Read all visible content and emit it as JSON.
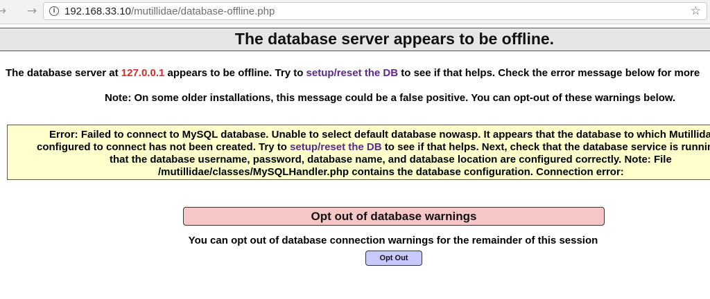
{
  "browser": {
    "back_glyph": "→",
    "forward_glyph": "→",
    "info_glyph": "i",
    "url_host": "192.168.33.10",
    "url_path": "/mutillidae/database-offline.php",
    "star_glyph": "☆"
  },
  "page": {
    "title": "The database server appears to be offline.",
    "line1_prefix": "The database server at ",
    "ip": "127.0.0.1",
    "line1_mid": " appears to be offline. Try to ",
    "setup_link": "setup/reset the DB",
    "line1_suffix": " to see if that helps. Check the error message below for more",
    "note": "Note: On some older installations, this message could be a false positive. You can opt-out of these warnings below."
  },
  "error": {
    "line1": "Error: Failed to connect to MySQL database. Unable to select default database nowasp. It appears that the database to which Mutillidae is",
    "line2_prefix": "configured to connect has not been created. Try to ",
    "line2_link": "setup/reset the DB",
    "line2_suffix": " to see if that helps. Next, check that the database service is running and",
    "line3": "that the database username, password, database name, and database location are configured correctly. Note: File",
    "line4": "/mutillidae/classes/MySQLHandler.php contains the database configuration. Connection error:"
  },
  "optout": {
    "header": "Opt out of database warnings",
    "description": "You can opt out of database connection warnings for the remainder of this session",
    "button_label": "Opt Out"
  },
  "colors": {
    "ip": "#c9302c",
    "link": "#5b2a8a",
    "error_bg": "#ffffcc",
    "optout_header_bg": "#f7c6c6",
    "optout_button_bg": "#c7c9ff"
  }
}
